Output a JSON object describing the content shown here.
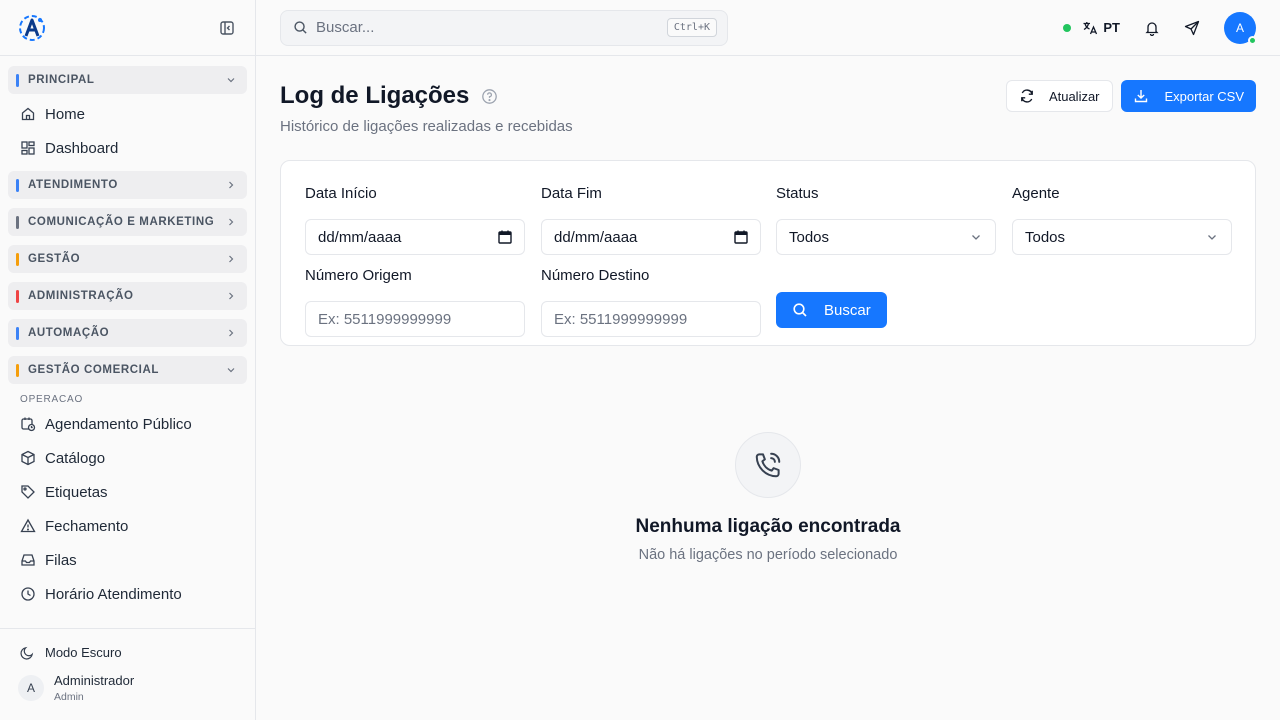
{
  "sidebar": {
    "groups_top": [
      {
        "label": "PRINCIPAL",
        "color": "#3b82f6",
        "expanded": true
      }
    ],
    "principal_items": [
      {
        "label": "Home",
        "icon": "home-icon"
      },
      {
        "label": "Dashboard",
        "icon": "dashboard-icon"
      }
    ],
    "groups": [
      {
        "label": "ATENDIMENTO",
        "color": "#3b82f6"
      },
      {
        "label": "COMUNICAÇÃO E MARKETING",
        "color": "#6b7280"
      },
      {
        "label": "GESTÃO",
        "color": "#f59e0b"
      },
      {
        "label": "ADMINISTRAÇÃO",
        "color": "#ef4444"
      },
      {
        "label": "AUTOMAÇÃO",
        "color": "#3b82f6"
      },
      {
        "label": "GESTÃO COMERCIAL",
        "color": "#f59e0b"
      }
    ],
    "subheading": "OPERACAO",
    "operacao_items": [
      {
        "label": "Agendamento Público",
        "icon": "calendar-clock-icon"
      },
      {
        "label": "Catálogo",
        "icon": "package-icon"
      },
      {
        "label": "Etiquetas",
        "icon": "tag-icon"
      },
      {
        "label": "Fechamento",
        "icon": "warning-icon"
      },
      {
        "label": "Filas",
        "icon": "inbox-icon"
      },
      {
        "label": "Horário Atendimento",
        "icon": "clock-icon"
      }
    ],
    "dark_mode_label": "Modo Escuro",
    "user": {
      "initial": "A",
      "name": "Administrador",
      "role": "Admin"
    }
  },
  "topbar": {
    "search_placeholder": "Buscar...",
    "shortcut": "Ctrl+K",
    "language": "PT",
    "avatar_initial": "A"
  },
  "page": {
    "title": "Log de Ligações",
    "subtitle": "Histórico de ligações realizadas e recebidas",
    "refresh_label": "Atualizar",
    "export_label": "Exportar CSV"
  },
  "filters": {
    "start_label": "Data Início",
    "start_value": "dd/mm/aaaa",
    "end_label": "Data Fim",
    "end_value": "dd/mm/aaaa",
    "status_label": "Status",
    "status_value": "Todos",
    "agent_label": "Agente",
    "agent_value": "Todos",
    "origin_label": "Número Origem",
    "origin_placeholder": "Ex: 5511999999999",
    "dest_label": "Número Destino",
    "dest_placeholder": "Ex: 5511999999999",
    "search_button": "Buscar"
  },
  "empty_state": {
    "title": "Nenhuma ligação encontrada",
    "subtitle": "Não há ligações no período selecionado"
  },
  "colors": {
    "primary": "#1677ff",
    "online": "#22c55e"
  }
}
